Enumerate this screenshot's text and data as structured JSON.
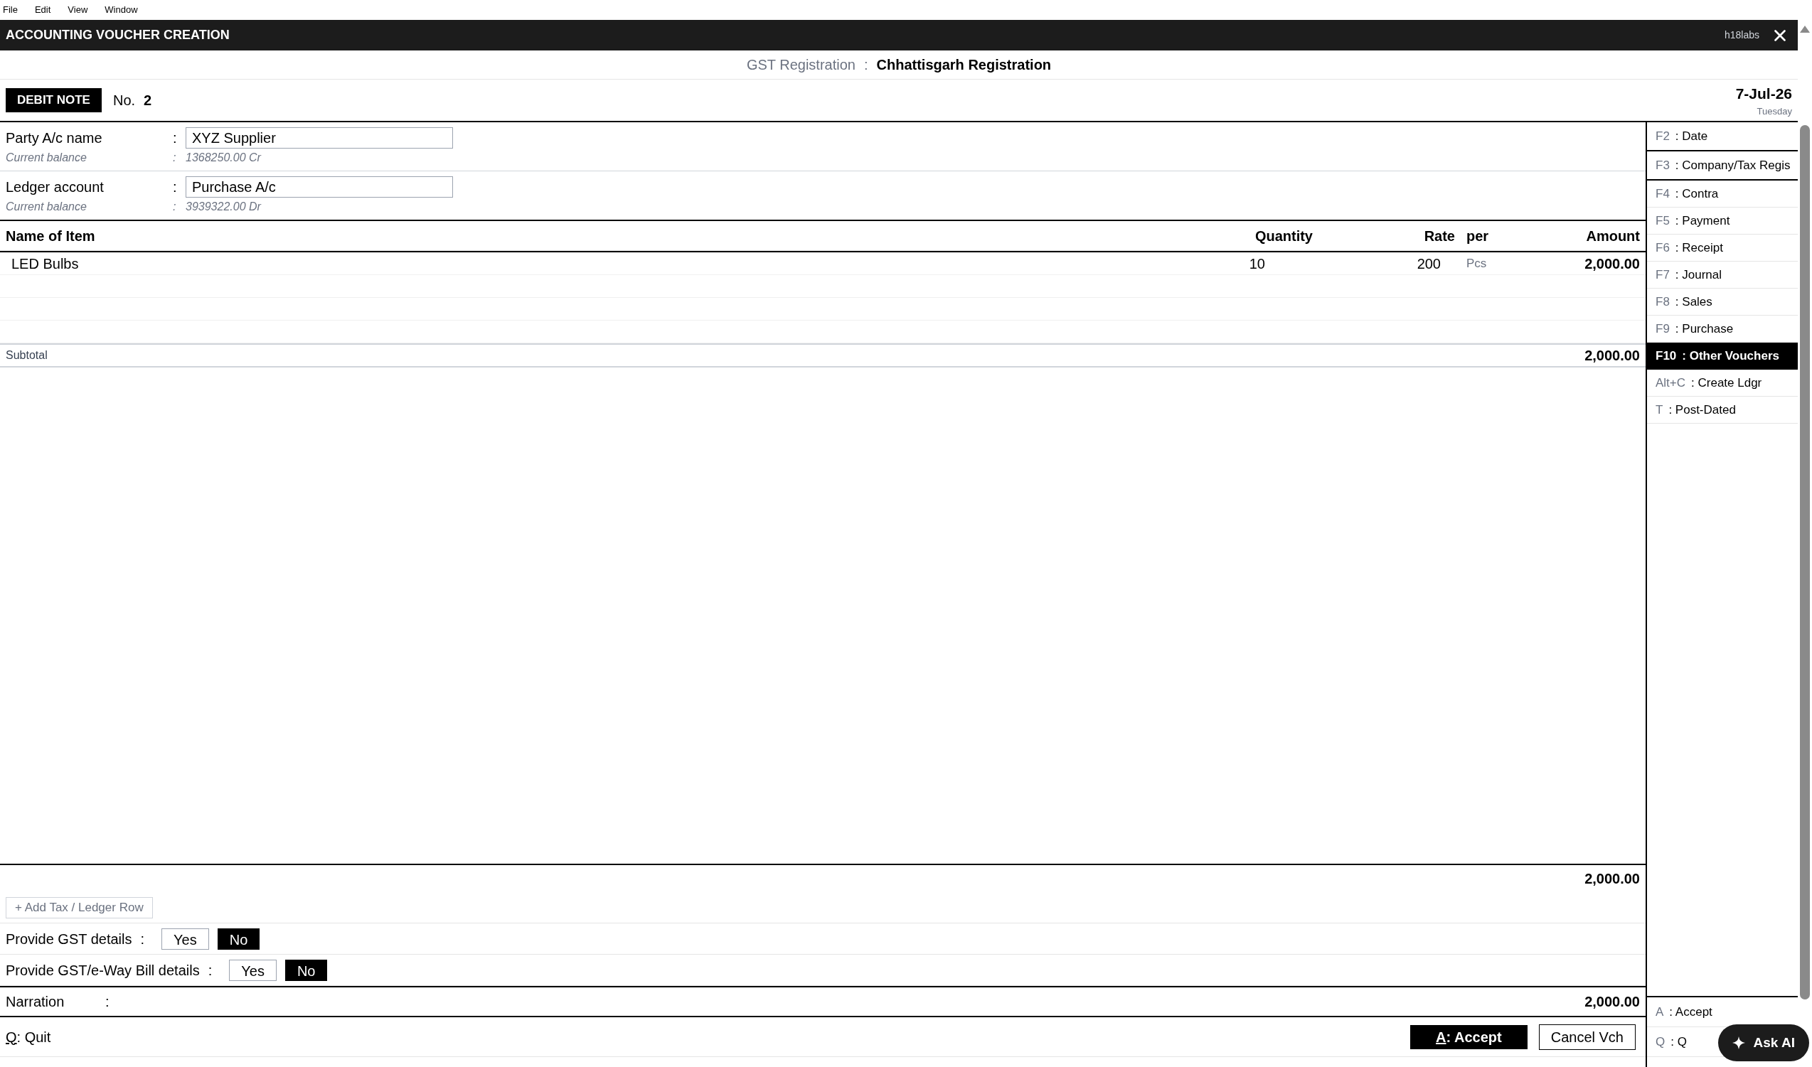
{
  "menu_bar": [
    "File",
    "Edit",
    "View",
    "Window"
  ],
  "window": {
    "title": "ACCOUNTING VOUCHER CREATION",
    "brand": "h18labs"
  },
  "registration": {
    "label": "GST Registration",
    "separator": ":",
    "value": "Chhattisgarh Registration"
  },
  "voucher": {
    "type": "DEBIT NOTE",
    "number_label": "No.",
    "number": "2",
    "date": "7-Jul-26",
    "day": "Tuesday"
  },
  "accounts": [
    {
      "label": "Party A/c name",
      "separator": ":",
      "value": "XYZ Supplier",
      "balance_label": "Current balance",
      "balance_separator": ":",
      "balance": "1368250.00 Cr"
    },
    {
      "label": "Ledger account",
      "separator": ":",
      "value": "Purchase A/c",
      "balance_label": "Current balance",
      "balance_separator": ":",
      "balance": "3939322.00 Dr"
    }
  ],
  "table": {
    "columns": [
      "Name of Item",
      "Quantity",
      "Rate",
      "per",
      "Amount"
    ],
    "rows": [
      {
        "name": "LED Bulbs",
        "quantity": "10",
        "rate": "200",
        "per": "Pcs",
        "amount": "2,000.00"
      }
    ],
    "subtotal_label": "Subtotal",
    "subtotal": "2,000.00",
    "total": "2,000.00"
  },
  "add_row_button": "+ Add Tax / Ledger Row",
  "toggles": [
    {
      "label": "Provide GST details",
      "separator": ":",
      "options": [
        {
          "label": "Yes",
          "selected": false
        },
        {
          "label": "No",
          "selected": true
        }
      ]
    },
    {
      "label": "Provide GST/e-Way Bill details",
      "separator": ":",
      "options": [
        {
          "label": "Yes",
          "selected": false
        },
        {
          "label": "No",
          "selected": true
        }
      ]
    }
  ],
  "narration": {
    "label": "Narration",
    "separator": ":",
    "amount": "2,000.00"
  },
  "footer": {
    "quit": {
      "shortcut": "Q",
      "label": ": Quit"
    },
    "accept": {
      "shortcut": "A",
      "label": ": Accept"
    },
    "cancel": "Cancel Vch"
  },
  "sidebar": {
    "items": [
      {
        "shortcut": "F2",
        "label": ": Date",
        "selected": false
      },
      {
        "shortcut": "F3",
        "label": ": Company/Tax Regis",
        "selected": false
      },
      {
        "shortcut": "F4",
        "label": ": Contra",
        "selected": false
      },
      {
        "shortcut": "F5",
        "label": ": Payment",
        "selected": false
      },
      {
        "shortcut": "F6",
        "label": ": Receipt",
        "selected": false
      },
      {
        "shortcut": "F7",
        "label": ": Journal",
        "selected": false
      },
      {
        "shortcut": "F8",
        "label": ": Sales",
        "selected": false
      },
      {
        "shortcut": "F9",
        "label": ": Purchase",
        "selected": false
      },
      {
        "shortcut": "F10",
        "label": ": Other Vouchers",
        "selected": true
      },
      {
        "shortcut": "Alt+C",
        "label": ": Create Ldgr",
        "selected": false
      },
      {
        "shortcut": "T",
        "label": ": Post-Dated",
        "selected": false
      }
    ],
    "bottom_items": [
      {
        "shortcut": "A",
        "label": ": Accept"
      },
      {
        "shortcut": "Q",
        "label": ": Q"
      }
    ]
  },
  "ask_ai": "Ask AI"
}
